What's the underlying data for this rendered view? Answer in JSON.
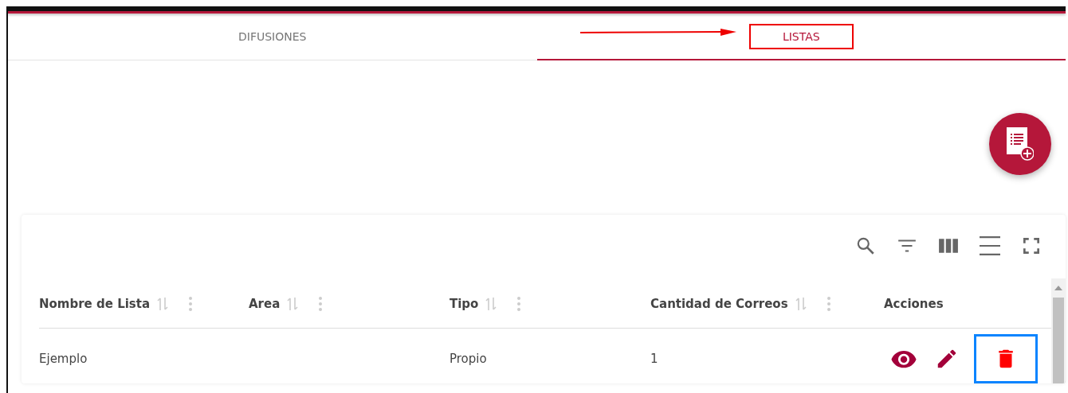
{
  "tabs": [
    {
      "label": "DIFUSIONES",
      "selected": false,
      "highlighted": false
    },
    {
      "label": "LISTAS",
      "selected": true,
      "highlighted": true
    }
  ],
  "table": {
    "columns": [
      {
        "label": "Nombre de Lista",
        "sortable": true
      },
      {
        "label": "Area",
        "sortable": true
      },
      {
        "label": "Tipo",
        "sortable": true
      },
      {
        "label": "Cantidad de Correos",
        "sortable": true
      },
      {
        "label": "Acciones",
        "sortable": false
      }
    ],
    "rows": [
      {
        "cells": [
          "Ejemplo",
          "",
          "Propio",
          "1"
        ],
        "actions": [
          {
            "kind": "view",
            "highlighted": false
          },
          {
            "kind": "edit",
            "highlighted": false
          },
          {
            "kind": "delete",
            "highlighted": true
          }
        ]
      }
    ]
  }
}
